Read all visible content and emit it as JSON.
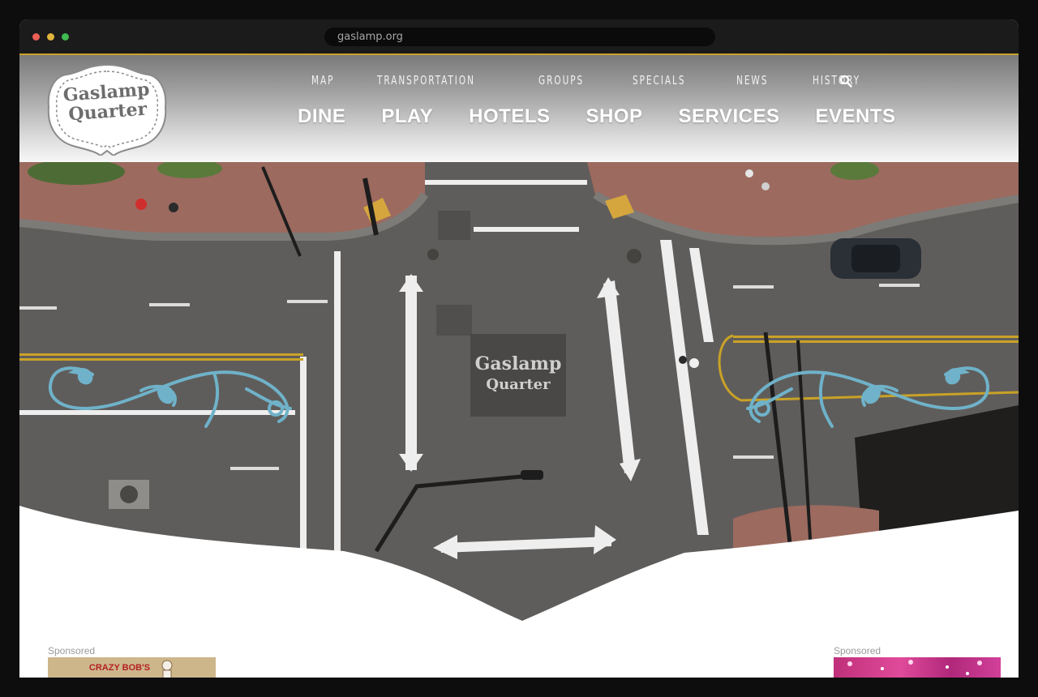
{
  "browser": {
    "url": "gaslamp.org"
  },
  "logo": {
    "line1": "Gaslamp",
    "line2": "Quarter"
  },
  "nav_top": [
    "MAP",
    "TRANSPORTATION",
    "GROUPS",
    "SPECIALS",
    "NEWS",
    "HISTORY"
  ],
  "nav_main": [
    "DINE",
    "PLAY",
    "HOTELS",
    "SHOP",
    "SERVICES",
    "EVENTS"
  ],
  "hero": {
    "stencil_line1": "Gaslamp",
    "stencil_line2": "Quarter"
  },
  "ads": [
    {
      "label": "Sponsored",
      "text": "CRAZY BOB'S"
    },
    {
      "label": "Sponsored",
      "text": ""
    }
  ],
  "colors": {
    "accent_gold": "#c9a227",
    "ornament_blue": "#6fb2c9",
    "road": "#5c5a58",
    "sidewalk_brick": "#a0675b"
  },
  "icons": {
    "search": "search-icon",
    "ornament_left": "ornament-left-icon",
    "ornament_right": "ornament-right-icon"
  }
}
